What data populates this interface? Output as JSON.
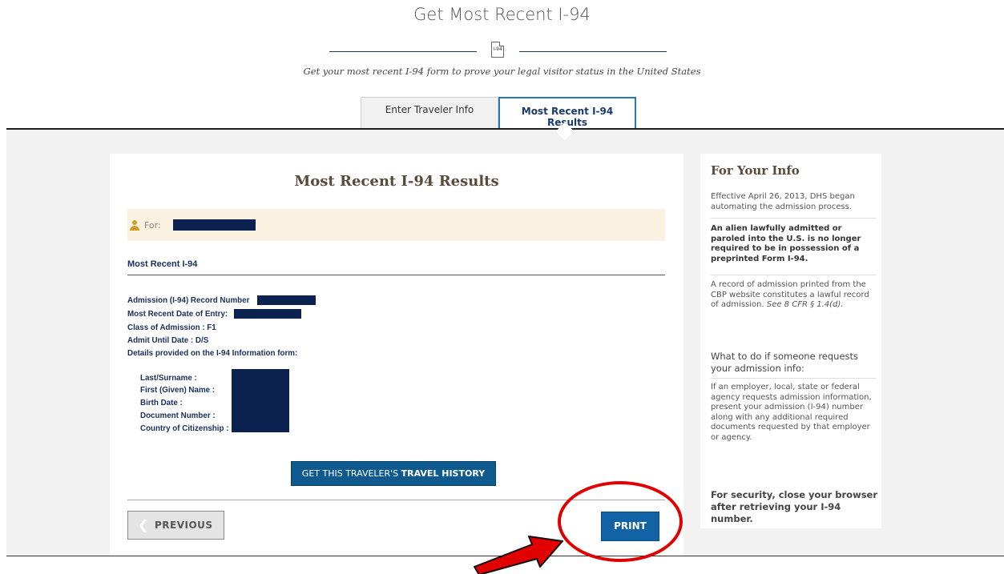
{
  "header": {
    "title": "Get Most Recent I-94",
    "icon_text": "I-94",
    "subtitle": "Get your most recent I-94 form to prove your legal visitor status in the United States"
  },
  "tabs": [
    {
      "label": "Enter Traveler Info",
      "active": false
    },
    {
      "label": "Most Recent I-94 Results",
      "active": true
    }
  ],
  "results": {
    "heading": "Most Recent I-94 Results",
    "for_label": "For:",
    "section_title": "Most Recent I-94",
    "details": {
      "admission_record_label": "Admission (I-94) Record Number",
      "date_of_entry_label": "Most Recent Date of Entry:",
      "class_of_admission": "Class of Admission : F1",
      "admit_until": "Admit Until Date : D/S",
      "details_intro": "Details provided on the I-94 Information form:"
    },
    "traveler_fields": [
      "Last/Surname :",
      "First (Given) Name :",
      "Birth Date :",
      "Document Number :",
      "Country of Citizenship :"
    ],
    "travel_history_button": {
      "prefix": "GET THIS TRAVELER'S",
      "bold": "TRAVEL HISTORY"
    },
    "previous_button": "PREVIOUS",
    "print_button": "PRINT"
  },
  "info": {
    "heading": "For Your Info",
    "para1": "Effective April 26, 2013, DHS began automating the admission process.",
    "para2": "An alien lawfully admitted or paroled into the U.S. is no longer required to be in possession of a preprinted Form I-94.",
    "para3_main": "A record of admission printed from the CBP website constitutes a lawful record of admission.",
    "para3_cite": "See 8 CFR § 1.4(d).",
    "sub_heading": "What to do if someone requests your admission info:",
    "para4": "If an employer, local, state or federal agency requests admission information, present your admission (I-94) number along with any additional required documents requested by that employer or agency.",
    "security_note": "For security, close your browser after retrieving your I-94 number."
  },
  "colors": {
    "accent_blue": "#1263a6",
    "navy_text": "#1a2e5a",
    "redaction": "#0b2150",
    "annotation_red": "#e10000",
    "for_bar_bg": "#faf1e0"
  }
}
